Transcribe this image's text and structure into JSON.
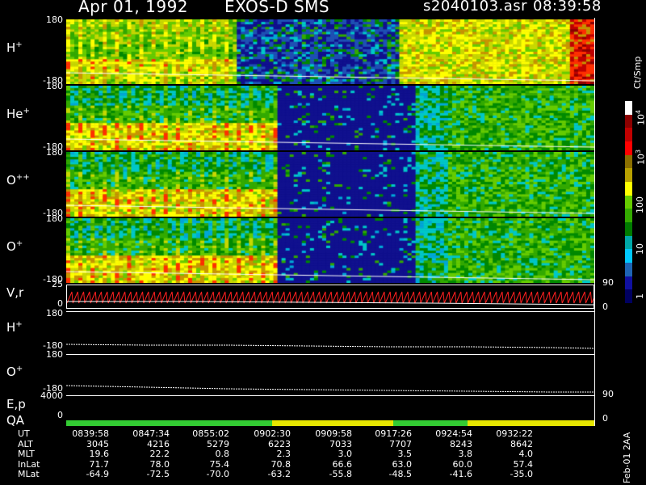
{
  "header": {
    "date": "Apr 01, 1992",
    "mission": "EXOS-D SMS",
    "file": "s2040103.asr",
    "time": "08:39:58"
  },
  "panels": [
    {
      "id": "hplus",
      "label": "H",
      "sup": "+",
      "top_tick": "180",
      "bottom_tick": "-180",
      "profile": "h"
    },
    {
      "id": "heplus",
      "label": "He",
      "sup": "+",
      "top_tick": "180",
      "bottom_tick": "-180",
      "profile": "he"
    },
    {
      "id": "oplusplus",
      "label": "O",
      "sup": "++",
      "top_tick": "180",
      "bottom_tick": "-180",
      "profile": "o"
    },
    {
      "id": "oplus",
      "label": "O",
      "sup": "+",
      "top_tick": "180",
      "bottom_tick": "-180",
      "profile": "o"
    }
  ],
  "line_panels": [
    {
      "id": "vr",
      "label": "V,r",
      "top_tick": "25",
      "bottom_tick": "0",
      "right_top": "90",
      "right_bottom": "0"
    },
    {
      "id": "hplus2",
      "label": "H",
      "sup": "+",
      "top_tick": "180",
      "bottom_tick": "-180"
    },
    {
      "id": "oplus2",
      "label": "O",
      "sup": "+",
      "top_tick": "180",
      "bottom_tick": "-180"
    },
    {
      "id": "ep",
      "label": "E,p",
      "top_tick": "4000",
      "right_top": "90"
    },
    {
      "id": "qa",
      "label": "QA",
      "bottom_tick": "0",
      "right_bottom": "0"
    }
  ],
  "colorbar": {
    "unit": "Ct/Smp",
    "labels": [
      "10^4",
      "10^3",
      "100",
      "10",
      "1"
    ],
    "colors": [
      "#ffffff",
      "#8b0000",
      "#c00000",
      "#ff0000",
      "#8b6f00",
      "#b8a000",
      "#ffff00",
      "#66cc00",
      "#33aa00",
      "#007a00",
      "#00a8a8",
      "#00c8ff",
      "#1e64b4",
      "#1010a0",
      "#000060"
    ]
  },
  "qa_bar": {
    "segments": [
      {
        "frac": 0.39,
        "color": "#33cc33"
      },
      {
        "frac": 0.23,
        "color": "#e6e600"
      },
      {
        "frac": 0.14,
        "color": "#33cc33"
      },
      {
        "frac": 0.24,
        "color": "#e6e600"
      }
    ]
  },
  "orbit_table": {
    "rows": [
      {
        "name": "UT",
        "values": [
          "0839:58",
          "0847:34",
          "0855:02",
          "0902:30",
          "0909:58",
          "0917:26",
          "0924:54",
          "0932:22"
        ]
      },
      {
        "name": "ALT",
        "values": [
          "3045",
          "4216",
          "5279",
          "6223",
          "7033",
          "7707",
          "8243",
          "8642"
        ]
      },
      {
        "name": "MLT",
        "values": [
          "19.6",
          "22.2",
          "0.8",
          "2.3",
          "3.0",
          "3.5",
          "3.8",
          "4.0"
        ]
      },
      {
        "name": "InLat",
        "values": [
          "71.7",
          "78.0",
          "75.4",
          "70.8",
          "66.6",
          "63.0",
          "60.0",
          "57.4"
        ]
      },
      {
        "name": "MLat",
        "values": [
          "-64.9",
          "-72.5",
          "-70.0",
          "-63.2",
          "-55.8",
          "-48.5",
          "-41.6",
          "-35.0"
        ]
      }
    ]
  },
  "side_note": "Feb-01 2AA"
}
